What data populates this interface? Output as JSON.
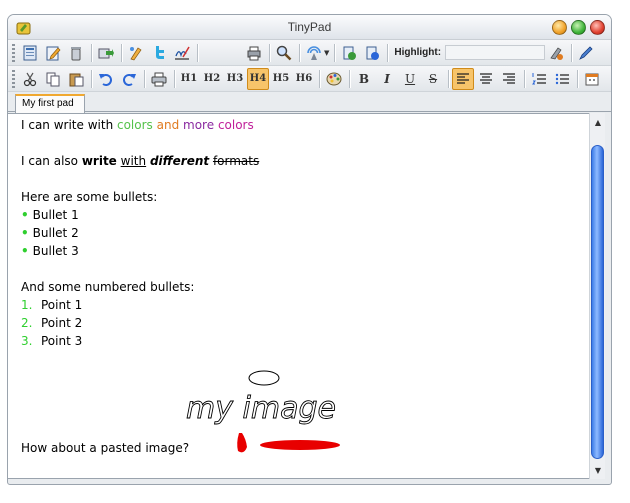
{
  "window": {
    "title": "TinyPad"
  },
  "toolbar1": {
    "highlight_label": "Highlight:",
    "highlight_value": "",
    "buttons": [
      "new-icon",
      "edit-icon",
      "trash-icon",
      "export-icon",
      "clean-icon",
      "twitter-icon",
      "signature-icon",
      "print-preview-icon",
      "search-icon",
      "broadcast-icon",
      "copy-style-icon",
      "paste-style-icon",
      "clear-highlight-icon",
      "pen-icon"
    ]
  },
  "toolbar2": {
    "headings": [
      "H1",
      "H2",
      "H3",
      "H4",
      "H5",
      "H6"
    ],
    "active_heading": "H4",
    "format": {
      "bold": "B",
      "italic": "I",
      "underline": "U",
      "strike": "S"
    }
  },
  "tabs": [
    {
      "label": "My first pad"
    }
  ],
  "document": {
    "line1": {
      "prefix": "I can write with ",
      "w_colors": "colors",
      "w_and": " and ",
      "w_more": "more",
      "w_space": " ",
      "w_colors2": "colors"
    },
    "line2": {
      "prefix": "I can also ",
      "bold": "write",
      "sp1": " ",
      "underline": "with",
      "sp2": " ",
      "bold_italic": "different",
      "sp3": " ",
      "strike": "formats"
    },
    "bullets_heading": "Here are some bullets:",
    "bullets": [
      "Bullet 1",
      "Bullet 2",
      "Bullet 3"
    ],
    "bullet_char": "•",
    "numbered_heading": "And some numbered bullets:",
    "numbered": [
      {
        "num": "1.",
        "text": "Point 1"
      },
      {
        "num": "2.",
        "text": "Point 2"
      },
      {
        "num": "3.",
        "text": "Point 3"
      }
    ],
    "pasted_prompt": "How about a pasted image?",
    "image_caption": "my image"
  },
  "colors": {
    "green": "#55c24b",
    "orange": "#e07b20",
    "purple": "#8a2aa0",
    "magenta": "#c0209a",
    "bullet": "#2fcf2f",
    "accent": "#f0a830"
  }
}
